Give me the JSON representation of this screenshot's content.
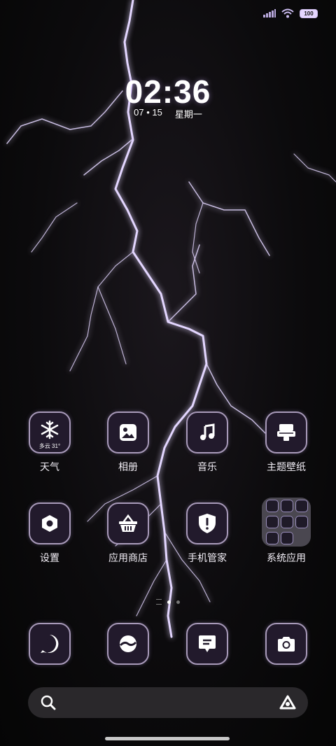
{
  "status_bar": {
    "battery": "100"
  },
  "clock": {
    "time": "02:36",
    "date": "07 • 15",
    "weekday": "星期一"
  },
  "apps_row1": [
    {
      "label": "天气",
      "icon": "snowflake-icon",
      "sub": "多云 31°"
    },
    {
      "label": "相册",
      "icon": "image-icon"
    },
    {
      "label": "音乐",
      "icon": "music-note-icon"
    },
    {
      "label": "主题壁纸",
      "icon": "theme-icon"
    }
  ],
  "apps_row2": [
    {
      "label": "设置",
      "icon": "hex-nut-icon"
    },
    {
      "label": "应用商店",
      "icon": "basket-icon"
    },
    {
      "label": "手机管家",
      "icon": "shield-icon"
    },
    {
      "label": "系统应用",
      "icon": "folder-icon"
    }
  ],
  "dock": [
    {
      "icon": "phone-icon"
    },
    {
      "icon": "browser-icon"
    },
    {
      "icon": "message-icon"
    },
    {
      "icon": "camera-icon"
    }
  ],
  "search": {
    "icon": "search-icon",
    "assistant_icon": "assistant-icon"
  },
  "colors": {
    "accent": "#a89ab9",
    "icon_bg": "#221a2c",
    "lightning": "#d9c9ff"
  }
}
